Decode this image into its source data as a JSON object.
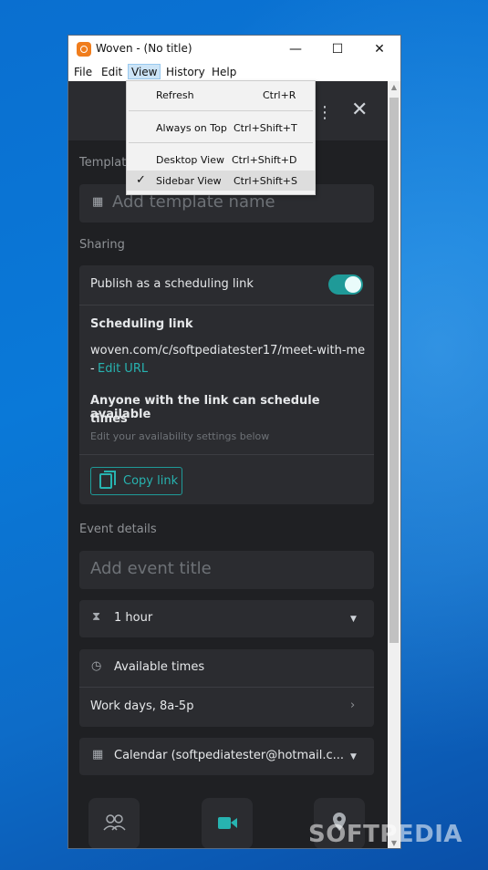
{
  "window": {
    "title": "Woven - (No title)",
    "minimize_glyph": "—",
    "maximize_glyph": "☐",
    "close_glyph": "✕"
  },
  "menubar": {
    "items": [
      {
        "label": "File"
      },
      {
        "label": "Edit"
      },
      {
        "label": "View"
      },
      {
        "label": "History"
      },
      {
        "label": "Help"
      }
    ]
  },
  "view_menu": {
    "items": [
      {
        "label": "Refresh",
        "shortcut": "Ctrl+R",
        "checked": false
      },
      {
        "label": "Always on Top",
        "shortcut": "Ctrl+Shift+T",
        "checked": false
      },
      {
        "label": "Desktop View",
        "shortcut": "Ctrl+Shift+D",
        "checked": false
      },
      {
        "label": "Sidebar View",
        "shortcut": "Ctrl+Shift+S",
        "checked": true
      }
    ]
  },
  "template": {
    "section_label": "Template",
    "name_placeholder": "Add template name"
  },
  "sharing": {
    "section_label": "Sharing",
    "publish_label": "Publish as a scheduling link",
    "publish_enabled": true,
    "scheduling_link_heading": "Scheduling link",
    "url": "woven.com/c/softpediatester17/meet-with-me",
    "url_prefix": "- ",
    "edit_url_label": "Edit URL",
    "anyone_heading_line1": "Anyone with the link can schedule available",
    "anyone_heading_line2": "times",
    "availability_hint": "Edit your availability settings below",
    "copy_link_label": "Copy link"
  },
  "event_details": {
    "section_label": "Event details",
    "title_placeholder": "Add event title",
    "duration": "1 hour",
    "available_times_label": "Available times",
    "work_days": "Work days, 8a-5p",
    "calendar": "Calendar (softpediatester@hotmail.c..."
  },
  "icons": {
    "calendar": "calendar-icon",
    "hourglass": "hourglass-icon",
    "clock": "clock-icon",
    "people": "people-icon",
    "video": "video-icon",
    "location": "location-pin-icon"
  },
  "colors": {
    "accent": "#27b3b0",
    "background": "#1f2023",
    "card": "#2b2c30"
  },
  "watermark": "SOFTPEDIA"
}
